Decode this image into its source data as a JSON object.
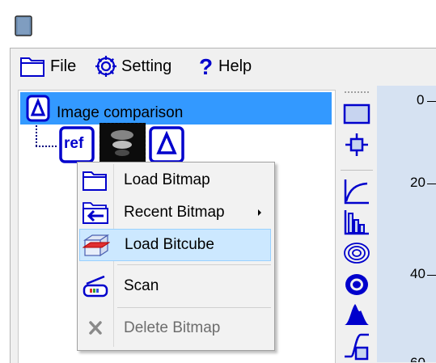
{
  "menu": {
    "file_label": "File",
    "setting_label": "Setting",
    "help_label": "Help"
  },
  "tree": {
    "root_label": "Image comparison",
    "ref_label": "ref"
  },
  "context_menu": {
    "items": [
      {
        "label": "Load Bitmap",
        "icon": "folder-icon",
        "enabled": true
      },
      {
        "label": "Recent Bitmap",
        "icon": "recent-arrow-icon",
        "enabled": true,
        "submenu": true
      },
      {
        "label": "Load Bitcube",
        "icon": "bitcube-icon",
        "enabled": true,
        "highlighted": true
      },
      {
        "label": "Scan",
        "icon": "scanner-icon",
        "enabled": true
      },
      {
        "label": "Delete Bitmap",
        "icon": "delete-x-icon",
        "enabled": false
      }
    ]
  },
  "ruler": {
    "labels": [
      "0",
      "20",
      "40",
      "60"
    ]
  },
  "colors": {
    "accent": "#3399ff",
    "icon_blue": "#0000cc",
    "highlight": "#cce8ff",
    "ruler_bg": "#d6e2f2"
  }
}
